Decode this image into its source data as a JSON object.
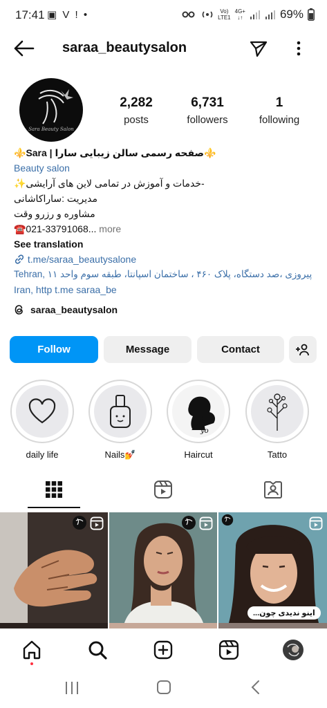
{
  "status_bar": {
    "time": "17:41",
    "left_icons": "▣ V ! •",
    "carrier_top": "Vo)",
    "carrier_bottom": "LTE1",
    "net_top": "4G+",
    "net_bottom": "↓↑",
    "battery": "69%"
  },
  "header": {
    "username": "saraa_beautysalon"
  },
  "profile": {
    "avatar_text": "Sara Beauty Salon",
    "stats": [
      {
        "value": "2,282",
        "label": "posts"
      },
      {
        "value": "6,731",
        "label": "followers"
      },
      {
        "value": "1",
        "label": "following"
      }
    ],
    "bio": {
      "line1": "⚜️صفحه رسمی سالن زیبایی سارا | Sara⚜️",
      "category": "Beauty salon",
      "line3": "-خدمات و آموزش در تمامی لاین های آرایشی✨",
      "line4": "مدیریت :ساراکاشانی",
      "line5": "مشاوره و رزرو وقت",
      "line6": "☎️021-33791068...",
      "more": " more",
      "see_translation": "See translation",
      "link": "t.me/saraa_beautysalone",
      "address_line1": "Tehran, پیروزی ،صد دستگاه، پلاک ۴۶۰ ، ساختمان اسپانتا، طبقه سوم واحد ۱۱",
      "address_line2": "Iran, http   t.me saraa_be"
    },
    "threads": "saraa_beautysalon"
  },
  "actions": {
    "follow": "Follow",
    "message": "Message",
    "contact": "Contact"
  },
  "highlights": [
    {
      "label": "daily life"
    },
    {
      "label": "Nails💅"
    },
    {
      "label": "Haircut"
    },
    {
      "label": "Tatto"
    }
  ],
  "posts": [
    {
      "caption": ""
    },
    {
      "caption": ""
    },
    {
      "caption": "اینو ندیدی چون..."
    }
  ],
  "colors": {
    "follow_button": "#0095f6",
    "link": "#3b6fa8",
    "secondary_text": "#737373"
  }
}
